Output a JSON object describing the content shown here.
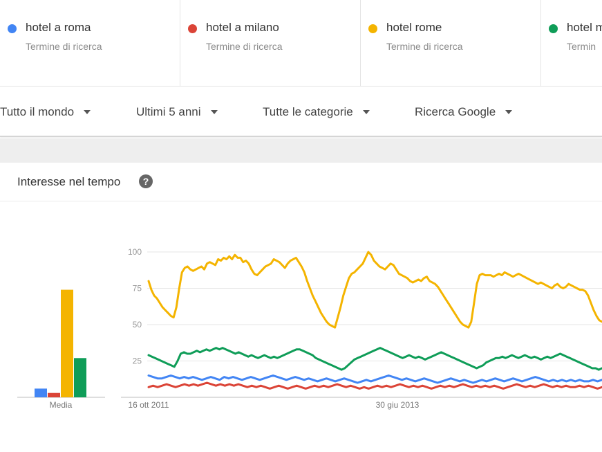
{
  "search_terms": [
    {
      "label": "hotel a roma",
      "subtitle": "Termine di ricerca",
      "color": "#4285f4"
    },
    {
      "label": "hotel a milano",
      "subtitle": "Termine di ricerca",
      "color": "#db4437"
    },
    {
      "label": "hotel rome",
      "subtitle": "Termine di ricerca",
      "color": "#f4b400"
    },
    {
      "label": "hotel m",
      "subtitle": "Termin",
      "color": "#0f9d58"
    }
  ],
  "filters": {
    "region": "Tutto il mondo",
    "period": "Ultimi 5 anni",
    "category": "Tutte le categorie",
    "source": "Ricerca Google"
  },
  "card": {
    "title": "Interesse nel tempo"
  },
  "chart_data": {
    "type": "line",
    "y_ticks": [
      "100",
      "75",
      "50",
      "25"
    ],
    "ylim": [
      0,
      100
    ],
    "x_tick_labels": [
      "16 ott 2011",
      "30 giu 2013"
    ],
    "average": {
      "label": "Media",
      "type": "bar",
      "values": [
        {
          "series": "hotel a roma",
          "value": 6
        },
        {
          "series": "hotel a milano",
          "value": 3
        },
        {
          "series": "hotel rome",
          "value": 74
        },
        {
          "series": "hotel m",
          "value": 27
        }
      ]
    },
    "series": [
      {
        "name": "hotel rome",
        "color": "#f4b400",
        "values": [
          80,
          74,
          70,
          68,
          65,
          62,
          60,
          58,
          56,
          55,
          62,
          75,
          86,
          89,
          90,
          88,
          87,
          88,
          89,
          90,
          88,
          92,
          93,
          92,
          91,
          95,
          94,
          96,
          95,
          97,
          95,
          98,
          96,
          96,
          93,
          94,
          92,
          88,
          85,
          84,
          86,
          88,
          90,
          91,
          92,
          95,
          94,
          93,
          91,
          89,
          92,
          94,
          95,
          96,
          93,
          90,
          86,
          80,
          75,
          70,
          66,
          62,
          58,
          55,
          52,
          50,
          49,
          48,
          55,
          62,
          70,
          76,
          82,
          85,
          86,
          88,
          90,
          92,
          96,
          100,
          98,
          94,
          92,
          90,
          89,
          88,
          90,
          92,
          91,
          88,
          85,
          84,
          83,
          82,
          80,
          79,
          80,
          81,
          80,
          82,
          83,
          80,
          79,
          78,
          76,
          73,
          70,
          67,
          64,
          61,
          58,
          55,
          52,
          50,
          49,
          48,
          52,
          65,
          78,
          84,
          85,
          84,
          84,
          84,
          83,
          84,
          85,
          84,
          86,
          85,
          84,
          83,
          84,
          85,
          84,
          83,
          82,
          81,
          80,
          79,
          78,
          79,
          78,
          77,
          76,
          75,
          77,
          78,
          76,
          75,
          76,
          78,
          77,
          76,
          75,
          74,
          74,
          73,
          70,
          65,
          60,
          56,
          53,
          52
        ]
      },
      {
        "name": "hotel m",
        "color": "#0f9d58",
        "values": [
          29,
          28,
          27,
          26,
          25,
          24,
          23,
          22,
          21,
          25,
          30,
          31,
          30,
          30,
          31,
          32,
          31,
          32,
          33,
          32,
          33,
          34,
          33,
          34,
          33,
          32,
          31,
          30,
          31,
          30,
          29,
          28,
          29,
          28,
          27,
          28,
          29,
          28,
          27,
          28,
          27,
          28,
          29,
          30,
          31,
          32,
          33,
          33,
          32,
          31,
          30,
          29,
          27,
          26,
          25,
          24,
          23,
          22,
          21,
          20,
          19,
          20,
          22,
          24,
          26,
          27,
          28,
          29,
          30,
          31,
          32,
          33,
          34,
          33,
          32,
          31,
          30,
          29,
          28,
          27,
          28,
          29,
          28,
          27,
          28,
          27,
          26,
          27,
          28,
          29,
          30,
          31,
          30,
          29,
          28,
          27,
          26,
          25,
          24,
          23,
          22,
          21,
          20,
          21,
          22,
          24,
          25,
          26,
          27,
          27,
          28,
          27,
          28,
          29,
          28,
          27,
          28,
          29,
          28,
          27,
          28,
          27,
          26,
          27,
          28,
          27,
          28,
          29,
          30,
          29,
          28,
          27,
          26,
          25,
          24,
          23,
          22,
          21,
          20,
          20,
          19,
          20
        ]
      },
      {
        "name": "hotel a roma",
        "color": "#4285f4",
        "values": [
          15,
          14,
          13,
          13,
          14,
          15,
          14,
          13,
          14,
          13,
          14,
          13,
          12,
          13,
          14,
          13,
          12,
          14,
          13,
          14,
          13,
          12,
          13,
          14,
          13,
          12,
          13,
          14,
          15,
          14,
          13,
          12,
          13,
          14,
          13,
          12,
          13,
          12,
          11,
          12,
          13,
          12,
          11,
          12,
          13,
          12,
          11,
          10,
          11,
          12,
          11,
          12,
          13,
          14,
          15,
          14,
          13,
          12,
          13,
          12,
          11,
          12,
          13,
          12,
          11,
          10,
          11,
          12,
          13,
          12,
          11,
          12,
          11,
          10,
          11,
          12,
          11,
          12,
          13,
          12,
          11,
          12,
          13,
          12,
          11,
          12,
          13,
          14,
          13,
          12,
          11,
          12,
          11,
          12,
          11,
          12,
          11,
          12,
          11,
          11,
          12,
          11,
          12
        ]
      },
      {
        "name": "hotel a milano",
        "color": "#db4437",
        "values": [
          7,
          8,
          7,
          8,
          9,
          8,
          7,
          8,
          9,
          8,
          9,
          8,
          9,
          10,
          9,
          8,
          9,
          8,
          9,
          8,
          9,
          8,
          7,
          8,
          7,
          8,
          7,
          6,
          7,
          8,
          7,
          6,
          7,
          8,
          7,
          6,
          7,
          8,
          7,
          8,
          7,
          8,
          9,
          8,
          7,
          8,
          7,
          6,
          7,
          6,
          7,
          8,
          7,
          8,
          7,
          8,
          9,
          8,
          7,
          8,
          7,
          8,
          7,
          6,
          7,
          8,
          7,
          8,
          7,
          8,
          9,
          8,
          7,
          8,
          7,
          8,
          7,
          8,
          7,
          6,
          7,
          8,
          9,
          8,
          7,
          8,
          7,
          8,
          9,
          8,
          7,
          8,
          7,
          8,
          7,
          7,
          8,
          7,
          8,
          7,
          6,
          7
        ]
      }
    ]
  }
}
